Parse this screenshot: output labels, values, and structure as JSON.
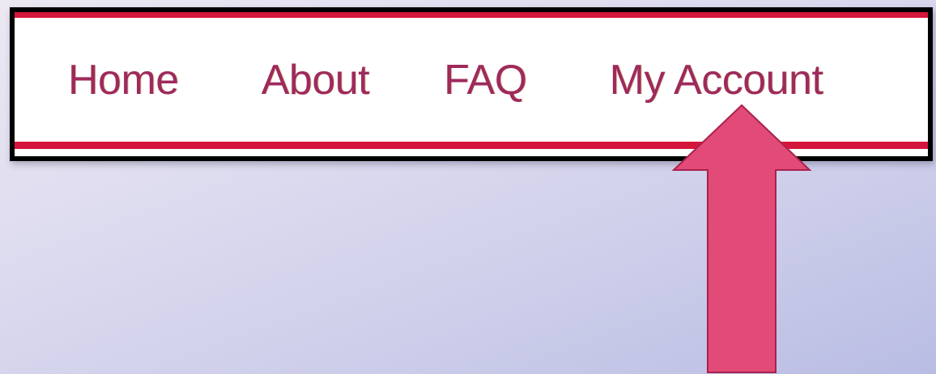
{
  "nav": {
    "items": [
      {
        "label": "Home"
      },
      {
        "label": "About"
      },
      {
        "label": "FAQ"
      },
      {
        "label": "My Account"
      }
    ]
  },
  "annotation": {
    "icon": "arrow-up-icon",
    "color": "#e24a78",
    "points_to": "My Account"
  },
  "colors": {
    "accent": "#d5163c",
    "link": "#9e2a5c",
    "frame": "#000000"
  }
}
